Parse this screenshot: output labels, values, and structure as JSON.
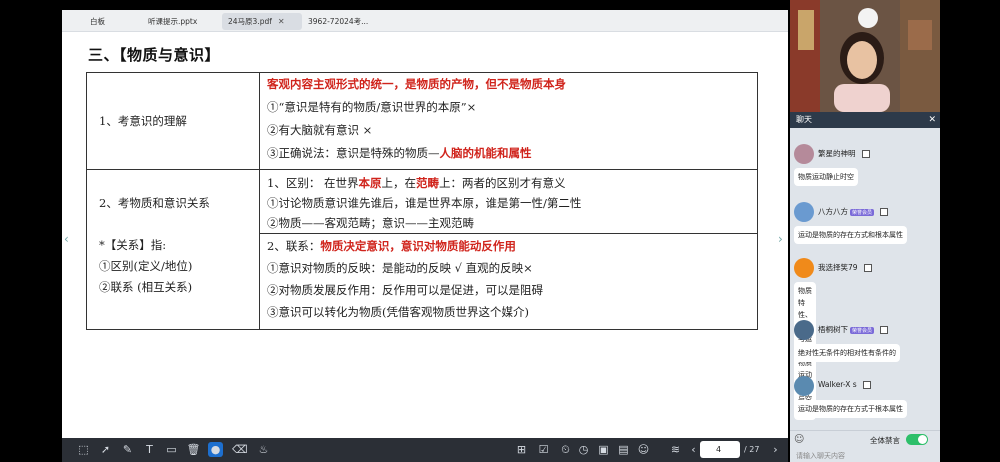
{
  "tabs": [
    {
      "label": "白板"
    },
    {
      "label": "听课提示.pptx"
    },
    {
      "label": "24马原3.pdf"
    },
    {
      "label": "3962-72024考..."
    }
  ],
  "slide": {
    "heading": "三、【物质与意识】",
    "row1": {
      "label": "1、考意识的理解",
      "line1": "客观内容主观形式的统一，是物质的产物，但不是物质本身",
      "line2": "①“意识是特有的物质/意识世界的本原”×",
      "line3": "②有大脑就有意识 ×",
      "line4_prefix": "③正确说法：意识是特殊的物质—",
      "line4_red": "人脑的机能和属性"
    },
    "row2": {
      "label": "2、考物质和意识关系",
      "rel_title": "*【关系】指:",
      "rel_1": "①区别(定义/地位)",
      "rel_2": "②联系 (相互关系)",
      "diff_a": "1、区别：  在世界",
      "diff_b": "本原",
      "diff_c": "上，在",
      "diff_d": "范畴",
      "diff_e": "上：两者的区别才有意义",
      "diff_2": "①讨论物质意识谁先谁后，谁是世界本原，谁是第一性/第二性",
      "diff_3": "②物质——客观范畴；意识——主观范畴",
      "link_a": "2、联系：",
      "link_b": "物质决定意识，意识对物质能动反作用",
      "link_2": "①意识对物质的反映：是能动的反映 √  直观的反映×",
      "link_3": "②对物质发展反作用：反作用可以是促进，可以是阻碍",
      "link_4": "③意识可以转化为物质(凭借客观物质世界这个媒介)"
    }
  },
  "toolbar": {
    "page_current": "4",
    "page_total": "/ 27"
  },
  "chat": {
    "title": "聊天",
    "messages": [
      {
        "user": "繁星的神明",
        "badge": "",
        "text": "物质运动静止时空"
      },
      {
        "user": "八方八方",
        "badge": "荣誉会员",
        "text": "运动是物质的存在方式和根本属性"
      },
      {
        "user": "我选择笑79",
        "badge": "",
        "text": "物质特性、物质与运动、物质运动\n时间与空间"
      },
      {
        "user": "梧桐树下",
        "badge": "荣誉会员",
        "text": "绝对性无条件的相对性有条件的"
      },
      {
        "user": "Walker-X s",
        "badge": "",
        "text": "运动是物质的存在方式于根本属性"
      }
    ],
    "mute_label": "全体禁言",
    "input_placeholder": "请输入聊天内容"
  },
  "colors": {
    "accent_red": "#d0241c",
    "toolbar_bg": "#2b2f36",
    "toggle_on": "#2dbf6a"
  }
}
